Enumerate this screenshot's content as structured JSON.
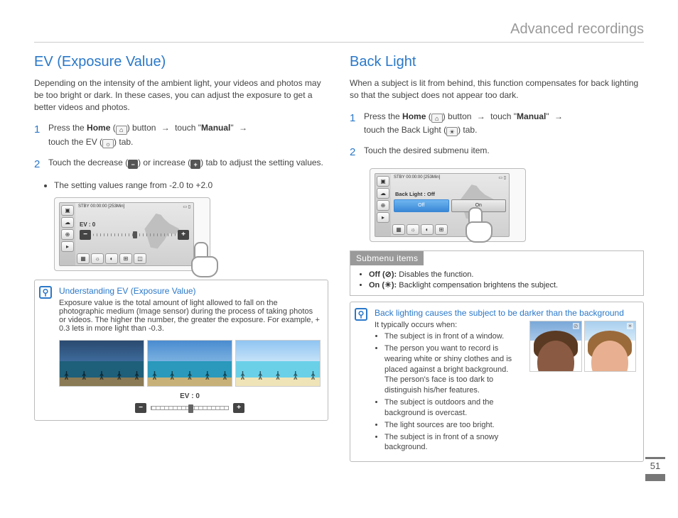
{
  "chapter": "Advanced recordings",
  "page_number": "51",
  "left": {
    "title": "EV (Exposure Value)",
    "intro": "Depending on the intensity of the ambient light, your videos and photos may be too bright or dark. In these cases, you can adjust the exposure to get a better videos and photos.",
    "step1_a": "Press the ",
    "step1_home": "Home",
    "step1_b": " button ",
    "step1_c": "touch \"",
    "step1_manual": "Manual",
    "step1_d": "\" ",
    "step1_e": "touch the EV (",
    "step1_f": ") tab.",
    "step2": "Touch the decrease (",
    "step2_b": ") or increase (",
    "step2_c": ") tab to adjust the setting values.",
    "step2_bullet": "The setting values range from -2.0 to +2.0",
    "lcd_top": "STBY 00:00:00 [253Min]",
    "lcd_ev": "EV : 0",
    "info_title": "Understanding EV (Exposure Value)",
    "info_body": "Exposure value is the total amount of light allowed to fall on the photographic medium (Image sensor) during the process of taking photos or videos. The higher the number, the greater the exposure. For example, + 0.3 lets in more light than -0.3.",
    "slider_lbl": "EV : 0"
  },
  "right": {
    "title": "Back Light",
    "intro": "When a subject is lit from behind, this function compensates for back lighting so that the subject does not appear too dark.",
    "step1_a": "Press the ",
    "step1_home": "Home",
    "step1_b": " button ",
    "step1_c": "touch \"",
    "step1_manual": "Manual",
    "step1_d": "\" ",
    "step1_e": "touch the Back Light (",
    "step1_f": ") tab.",
    "step2": "Touch the desired submenu item.",
    "lcd_top": "STBY 00:00:00 [253Min]",
    "lcd_bl": "Back Light : Off",
    "bl_off": "Off",
    "bl_on": "On",
    "submenu_title": "Submenu items",
    "submenu_off_lbl": "Off (",
    "submenu_off_b": "): ",
    "submenu_off_txt": "Disables the function.",
    "submenu_on_lbl": "On (",
    "submenu_on_b": "): ",
    "submenu_on_txt": "Backlight compensation brightens the subject.",
    "info_title": "Back lighting causes the subject to be darker than the background",
    "info_lead": "It typically occurs when:",
    "info_items": [
      "The subject is in front of a window.",
      "The person you want to record is wearing white or shiny clothes and is placed against a bright background. The person's face is too dark to distinguish his/her features.",
      "The subject is outdoors and the background is overcast.",
      "The light sources are too bright.",
      "The subject is in front of a snowy background."
    ],
    "p_tag_off": "⊘",
    "p_tag_on": "☀"
  }
}
